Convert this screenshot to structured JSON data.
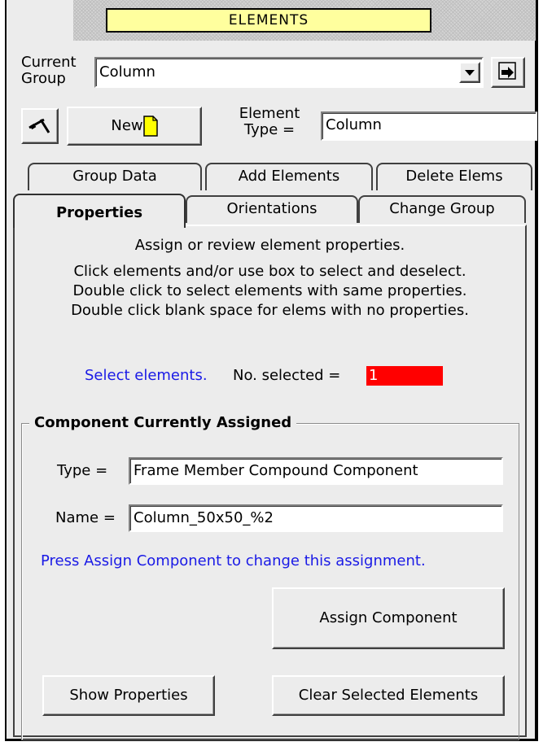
{
  "header": {
    "title": "ELEMENTS"
  },
  "group": {
    "label_line1": "Current",
    "label_line2": "Group",
    "value": "Column"
  },
  "toolbar": {
    "new_label": "New"
  },
  "element_type": {
    "label_line1": "Element",
    "label_line2": "Type =",
    "value": "Column"
  },
  "tabs_row1": [
    "Group Data",
    "Add Elements",
    "Delete Elems"
  ],
  "tabs_row2": [
    "Properties",
    "Orientations",
    "Change Group"
  ],
  "instructions": [
    "Assign or review element properties.",
    "Click elements and/or use box to select and deselect.",
    "Double click to select elements with same properties.",
    "Double click blank space for elems with no properties."
  ],
  "selection": {
    "prompt": "Select elements.",
    "count_label": "No. selected =",
    "count": "1"
  },
  "component": {
    "title": "Component Currently Assigned",
    "type_label": "Type =",
    "type_value": "Frame Member Compound Component",
    "name_label": "Name =",
    "name_value": "Column_50x50_%2",
    "hint": "Press Assign Component to change this assignment."
  },
  "buttons": {
    "assign": "Assign Component",
    "show": "Show Properties",
    "clear": "Clear Selected Elements"
  },
  "colors": {
    "title_bg": "#ffff9e",
    "count_bg": "#ff0000",
    "hint_text": "#1a1ae6"
  }
}
